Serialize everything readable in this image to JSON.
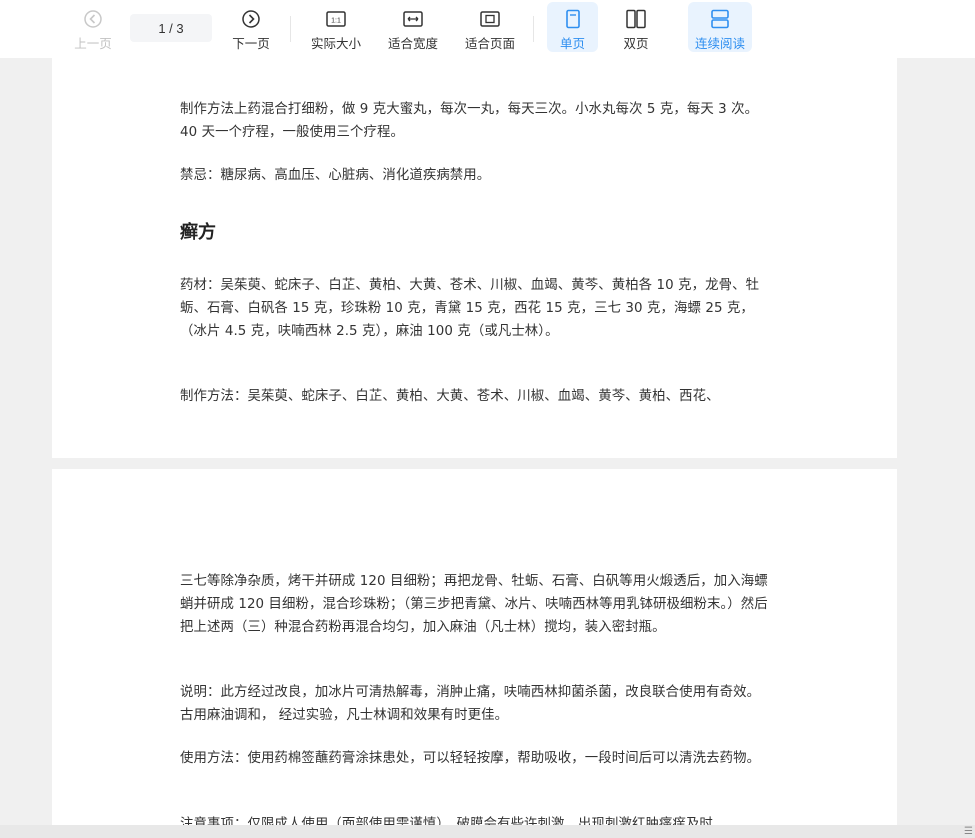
{
  "toolbar": {
    "prev": "上一页",
    "page_indicator": "1  / 3",
    "next": "下一页",
    "actual_size": "实际大小",
    "fit_width": "适合宽度",
    "fit_page": "适合页面",
    "single_page": "单页",
    "double_page": "双页",
    "continuous": "连续阅读",
    "active_color": "#2f8ff0"
  },
  "page1": {
    "p1": "制作方法上药混合打细粉，做 9 克大蜜丸，每次一丸，每天三次。小水丸每次 5 克，每天 3 次。40 天一个疗程，一般使用三个疗程。",
    "p2": "禁忌：糖尿病、高血压、心脏病、消化道疾病禁用。",
    "heading": "癣方",
    "p3": "药材：吴茱萸、蛇床子、白芷、黄柏、大黄、苍术、川椒、血竭、黄芩、黄柏各 10 克，龙骨、牡蛎、石膏、白矾各 15 克，珍珠粉 10 克，青黛 15 克，西花 15 克，三七 30 克，海螵 25 克，（冰片 4.5 克，呋喃西林 2.5 克），麻油 100 克（或凡士林）。",
    "p4": "制作方法：吴茱萸、蛇床子、白芷、黄柏、大黄、苍术、川椒、血竭、黄芩、黄柏、西花、"
  },
  "page2": {
    "p1": "三七等除净杂质，烤干并研成 120 目细粉；再把龙骨、牡蛎、石膏、白矾等用火煅透后，加入海螵蛸并研成 120 目细粉，混合珍珠粉；（第三步把青黛、冰片、呋喃西林等用乳钵研极细粉末。）然后把上述两（三）种混合药粉再混合均匀，加入麻油（凡士林）搅均，装入密封瓶。",
    "p2": "说明：此方经过改良，加冰片可清热解毒，消肿止痛，呋喃西林抑菌杀菌，改良联合使用有奇效。古用麻油调和， 经过实验，凡士林调和效果有时更佳。",
    "p3": "使用方法：使用药棉签蘸药膏涂抹患处，可以轻轻按摩，帮助吸收，一段时间后可以清洗去药物。",
    "p4": "注意事项：仅限成人使用（面部使用需谨慎），破膜会有些许刺激，出现刺激红肿瘙痒及时"
  }
}
